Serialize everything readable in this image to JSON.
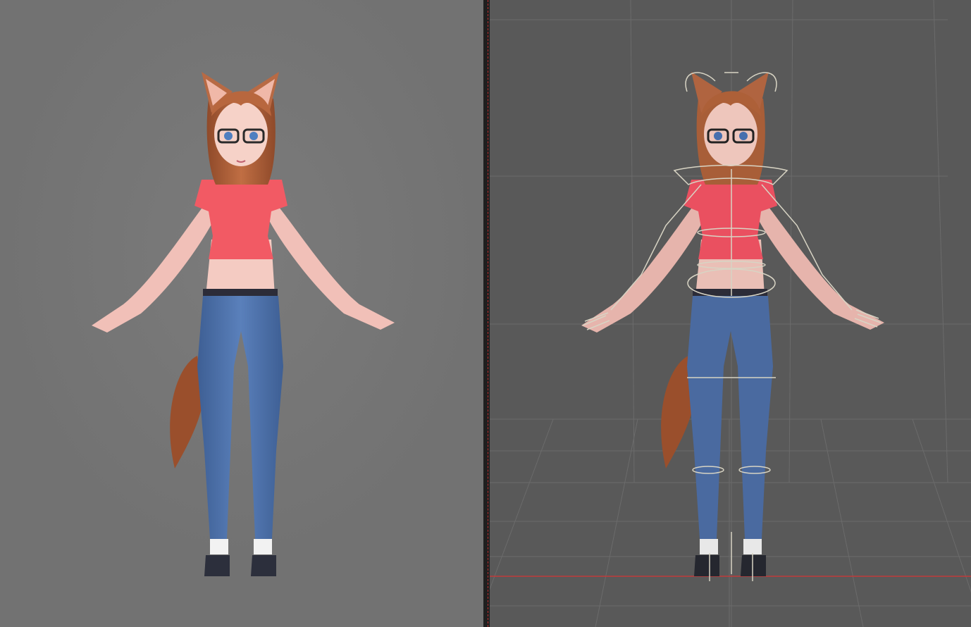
{
  "app": {
    "render_panel_name": "",
    "viewport_panel_name": ""
  },
  "colors": {
    "render_bg": "#727272",
    "viewport_bg": "#595959",
    "divider": "#1f1f1f",
    "grid_line": "#6a6a6a",
    "ground_axis": "#c03a3a",
    "rig_control": "#d8d4c4",
    "hair": "#b0603a",
    "top": "#f25a64",
    "jeans": "#4a6fa8",
    "skin": "#f3c7c0"
  },
  "icons": {
    "character": "fox-girl-character",
    "rig": "armature-rig"
  }
}
